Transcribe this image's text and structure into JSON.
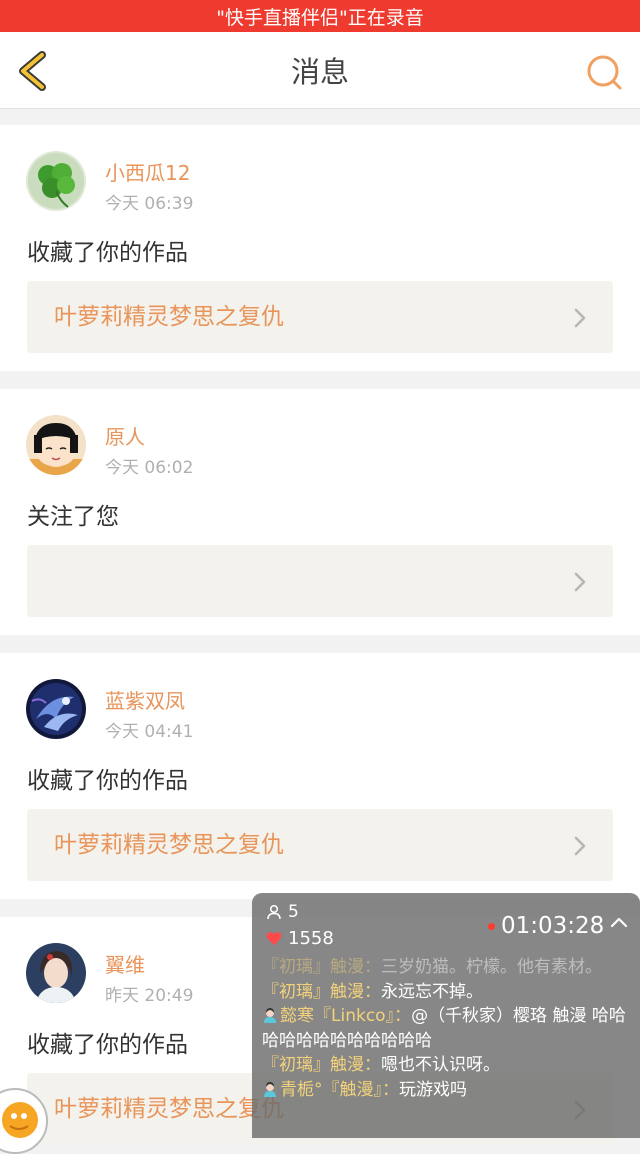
{
  "recording_banner": "\"快手直播伴侣\"正在录音",
  "header": {
    "title": "消息"
  },
  "messages": [
    {
      "name": "小西瓜12",
      "time": "今天 06:39",
      "action": "收藏了你的作品",
      "work_title": "叶萝莉精灵梦思之复仇"
    },
    {
      "name": "原人",
      "time": "今天 06:02",
      "action": "关注了您",
      "work_title": ""
    },
    {
      "name": "蓝紫双凤",
      "time": "今天 04:41",
      "action": "收藏了你的作品",
      "work_title": "叶萝莉精灵梦思之复仇"
    },
    {
      "name": "翼维",
      "time": "昨天 20:49",
      "action": "收藏了你的作品",
      "work_title": "叶萝莉精灵梦思之复仇"
    }
  ],
  "live_overlay": {
    "viewers": "5",
    "likes": "1558",
    "timer": "01:03:28",
    "comments": [
      {
        "author": "『初璃』触漫：",
        "text": "三岁奶猫。柠檬。他有素材。"
      },
      {
        "author": "『初璃』触漫：",
        "text": "永远忘不掉。"
      },
      {
        "author": "懿寒『Linkco』：",
        "text": "@（千秋家）樱珞 触漫    哈哈哈哈哈哈哈哈哈哈哈哈"
      },
      {
        "author": "『初璃』触漫：",
        "text": "嗯也不认识呀。"
      },
      {
        "author": "青栀°『触漫』：",
        "text": "玩游戏吗"
      }
    ]
  },
  "colors": {
    "accent": "#e8945a",
    "recording_bar": "#ee3a2f",
    "back_icon": "#f4c233"
  }
}
